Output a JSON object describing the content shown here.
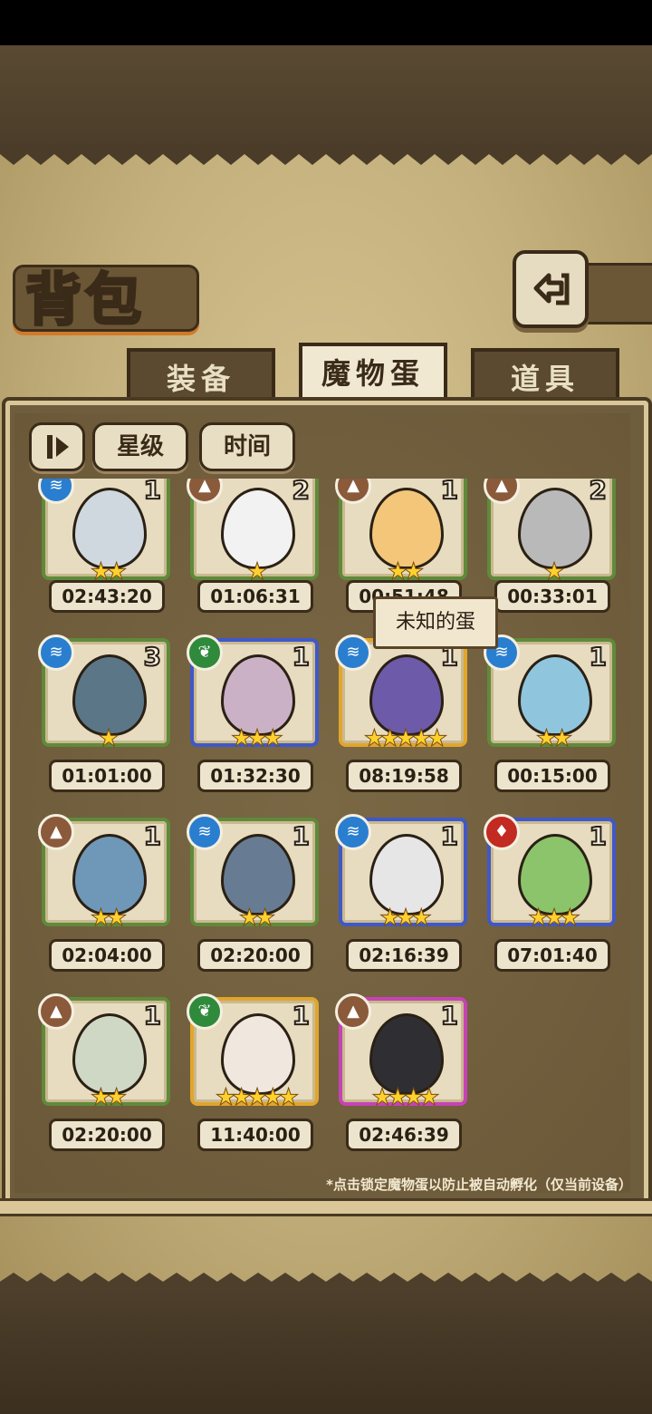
{
  "title": "背包",
  "tabs": [
    {
      "label": "装备",
      "active": false
    },
    {
      "label": "魔物蛋",
      "active": true
    },
    {
      "label": "道具",
      "active": false
    }
  ],
  "sort": {
    "toggle_icon": "order-toggle-icon",
    "by_star": "星级",
    "by_time": "时间"
  },
  "tooltip": "未知的蛋",
  "footnote": "*点击锁定魔物蛋以防止被自动孵化（仅当前设备）",
  "eggs": [
    {
      "count": "1",
      "stars": 2,
      "timer": "02:43:20",
      "frame": "green",
      "element": "water"
    },
    {
      "count": "2",
      "stars": 1,
      "timer": "01:06:31",
      "frame": "green",
      "element": "earth"
    },
    {
      "count": "1",
      "stars": 2,
      "timer": "00:51:48",
      "frame": "green",
      "element": "earth"
    },
    {
      "count": "2",
      "stars": 1,
      "timer": "00:33:01",
      "frame": "green",
      "element": "earth"
    },
    {
      "count": "3",
      "stars": 1,
      "timer": "01:01:00",
      "frame": "green",
      "element": "water"
    },
    {
      "count": "1",
      "stars": 3,
      "timer": "01:32:30",
      "frame": "blue",
      "element": "leaf"
    },
    {
      "count": "1",
      "stars": 5,
      "timer": "08:19:58",
      "frame": "gold",
      "element": "water"
    },
    {
      "count": "1",
      "stars": 2,
      "timer": "00:15:00",
      "frame": "green",
      "element": "water"
    },
    {
      "count": "1",
      "stars": 2,
      "timer": "02:04:00",
      "frame": "green",
      "element": "earth"
    },
    {
      "count": "1",
      "stars": 2,
      "timer": "02:20:00",
      "frame": "green",
      "element": "water"
    },
    {
      "count": "1",
      "stars": 3,
      "timer": "02:16:39",
      "frame": "blue",
      "element": "water"
    },
    {
      "count": "1",
      "stars": 3,
      "timer": "07:01:40",
      "frame": "blue",
      "element": "fire"
    },
    {
      "count": "1",
      "stars": 2,
      "timer": "02:20:00",
      "frame": "green",
      "element": "earth"
    },
    {
      "count": "1",
      "stars": 5,
      "timer": "11:40:00",
      "frame": "gold",
      "element": "leaf"
    },
    {
      "count": "1",
      "stars": 4,
      "timer": "02:46:39",
      "frame": "pink",
      "element": "earth"
    }
  ],
  "colors": {
    "frame_green": "#5f8a3a",
    "frame_blue": "#3f58c8",
    "frame_gold": "#e2a52c",
    "frame_pink": "#c742b5",
    "star": "#ffd12e"
  }
}
